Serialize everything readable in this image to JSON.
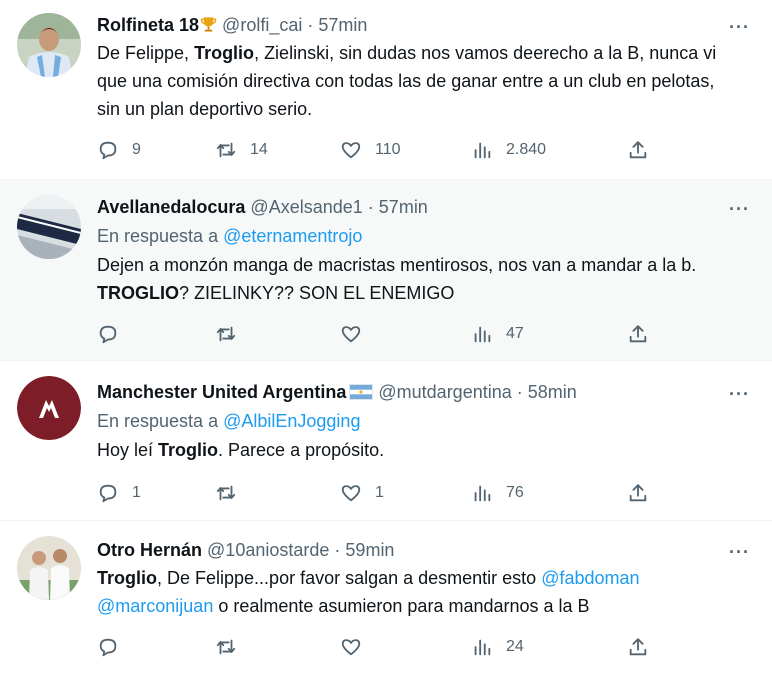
{
  "colors": {
    "text": "#0f1419",
    "muted": "#536471",
    "link": "#1d9bf0",
    "shaded_row": "#f7f9f9"
  },
  "tweets": [
    {
      "name": "Rolfineta 18",
      "badge": "trophy-icon",
      "handle": "@rolfi_cai",
      "sep": "·",
      "time": "57min",
      "more": "···",
      "body": [
        {
          "text": "De Felippe, "
        },
        {
          "text": "Troglio",
          "bold": true
        },
        {
          "text": ", Zielinski, sin dudas nos vamos deerecho a la B, nunca vi que una comisión directiva con todas las de ganar entre a un club en pelotas, sin un plan deportivo serio."
        }
      ],
      "replies": "9",
      "retweets": "14",
      "likes": "110",
      "views": "2.840"
    },
    {
      "name": "Avellanedalocura",
      "handle": "@Axelsande1",
      "sep": "·",
      "time": "57min",
      "more": "···",
      "reply_prefix": "En respuesta a ",
      "reply_to": "@eternamentrojo",
      "body": [
        {
          "text": "Dejen a monzón manga de macristas mentirosos, nos van a mandar a la b. "
        },
        {
          "text": "TROGLIO",
          "bold": true
        },
        {
          "text": "? ZIELINKY?? SON EL ENEMIGO"
        }
      ],
      "replies": "",
      "retweets": "",
      "likes": "",
      "views": "47"
    },
    {
      "name": "Manchester United Argentina",
      "badge": "argentina-flag-icon",
      "handle": "@mutdargentina",
      "sep": "·",
      "time": "58min",
      "more": "···",
      "reply_prefix": "En respuesta a ",
      "reply_to": "@AlbilEnJogging",
      "body": [
        {
          "text": "Hoy leí "
        },
        {
          "text": "Troglio",
          "bold": true
        },
        {
          "text": ". Parece a propósito."
        }
      ],
      "replies": "1",
      "retweets": "",
      "likes": "1",
      "views": "76"
    },
    {
      "name": "Otro Hernán",
      "handle": "@10aniostarde",
      "sep": "·",
      "time": "59min",
      "more": "···",
      "body": [
        {
          "text": "Troglio",
          "bold": true
        },
        {
          "text": ", De Felippe...por favor salgan a desmentir esto "
        },
        {
          "text": "@fabdoman",
          "mention": true
        },
        {
          "text": " "
        },
        {
          "text": "@marconijuan",
          "mention": true
        },
        {
          "text": " o realmente asumieron para mandarnos a la B"
        }
      ],
      "replies": "",
      "retweets": "",
      "likes": "",
      "views": "24"
    }
  ]
}
